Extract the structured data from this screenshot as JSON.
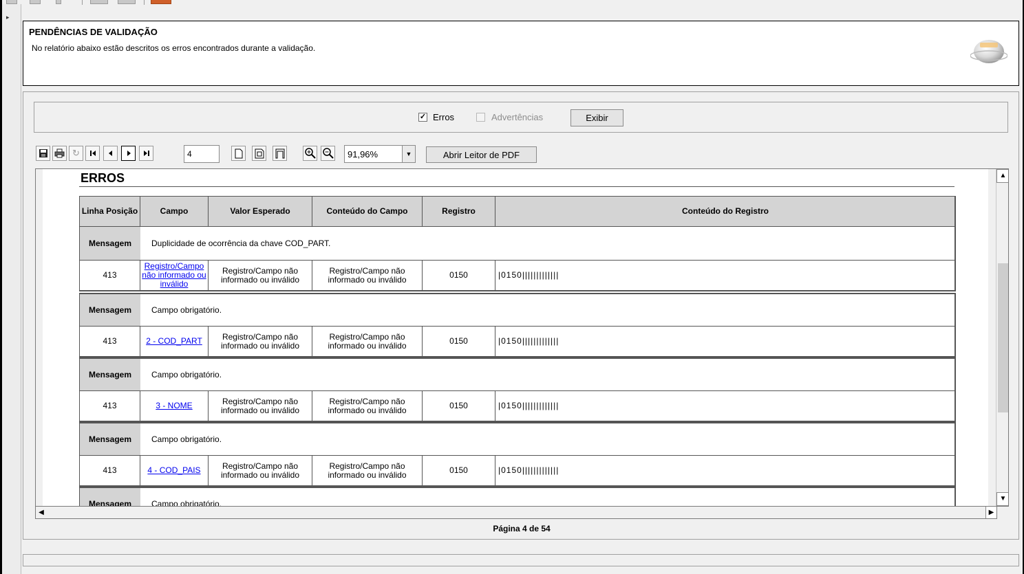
{
  "header": {
    "title": "PENDÊNCIAS DE VALIDAÇÃO",
    "subtitle": "No relatório abaixo estão descritos os erros encontrados durante a validação."
  },
  "filters": {
    "errors_label": "Erros",
    "errors_checked": true,
    "errors_mark": "✓",
    "warnings_label": "Advertências",
    "warnings_checked": false,
    "show_button": "Exibir"
  },
  "toolbar": {
    "page_number": "4",
    "zoom": "91,96%",
    "open_pdf_button": "Abrir Leitor de PDF",
    "icons": [
      "save-icon",
      "print-icon",
      "refresh-icon",
      "first-page-icon",
      "previous-page-icon",
      "next-page-icon",
      "last-page-icon",
      "single-page-icon",
      "facing-pages-icon",
      "fit-width-icon",
      "zoom-in-icon",
      "zoom-out-icon"
    ]
  },
  "report": {
    "section_title": "ERROS",
    "columns": [
      "Linha Posição",
      "Campo",
      "Valor Esperado",
      "Conteúdo do Campo",
      "Registro",
      "Conteúdo do Registro"
    ],
    "message_label": "Mensagem",
    "entries": [
      {
        "message": "Duplicidade de ocorrência da chave COD_PART.",
        "line": "413",
        "field": "Registro/Campo não informado ou inválido",
        "expected": "Registro/Campo não informado ou inválido",
        "content": "Registro/Campo não informado ou inválido",
        "record": "0150",
        "record_content": "|0150|||||||||||||"
      },
      {
        "message": "Campo obrigatório.",
        "line": "413",
        "field": "2 - COD_PART",
        "expected": "Registro/Campo não informado ou inválido",
        "content": "Registro/Campo não informado ou inválido",
        "record": "0150",
        "record_content": "|0150|||||||||||||"
      },
      {
        "message": "Campo obrigatório.",
        "line": "413",
        "field": "3 - NOME",
        "expected": "Registro/Campo não informado ou inválido",
        "content": "Registro/Campo não informado ou inválido",
        "record": "0150",
        "record_content": "|0150|||||||||||||"
      },
      {
        "message": "Campo obrigatório.",
        "line": "413",
        "field": "4 - COD_PAIS",
        "expected": "Registro/Campo não informado ou inválido",
        "content": "Registro/Campo não informado ou inválido",
        "record": "0150",
        "record_content": "|0150|||||||||||||"
      },
      {
        "message": "Campo obrigatório."
      }
    ]
  },
  "status": {
    "page_indicator": "Página 4 de 54"
  },
  "colors": {
    "header_gray": "#d4d4d4",
    "link_blue": "#0000ee",
    "window_bg": "#f0f0f0"
  }
}
